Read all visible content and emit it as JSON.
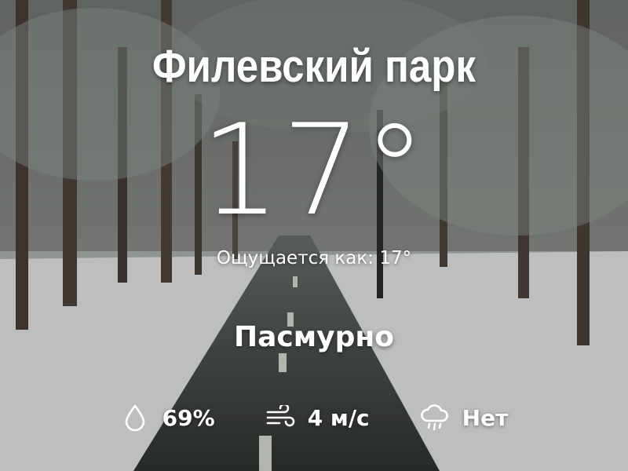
{
  "weather": {
    "location": "Филевский парк",
    "temperature": "17°",
    "feels_like": "Ощущается как: 17°",
    "condition": "Пасмурно"
  },
  "stats": {
    "humidity": {
      "value": "69%",
      "icon": "droplet-icon"
    },
    "wind": {
      "value": "4 м/с",
      "icon": "wind-icon"
    },
    "precipitation": {
      "value": "Нет",
      "icon": "cloud-rain-icon"
    }
  },
  "colors": {
    "text": "#ffffff",
    "snow": "#e9ecea",
    "road": "#3f4442",
    "trees": "#4a4440"
  }
}
